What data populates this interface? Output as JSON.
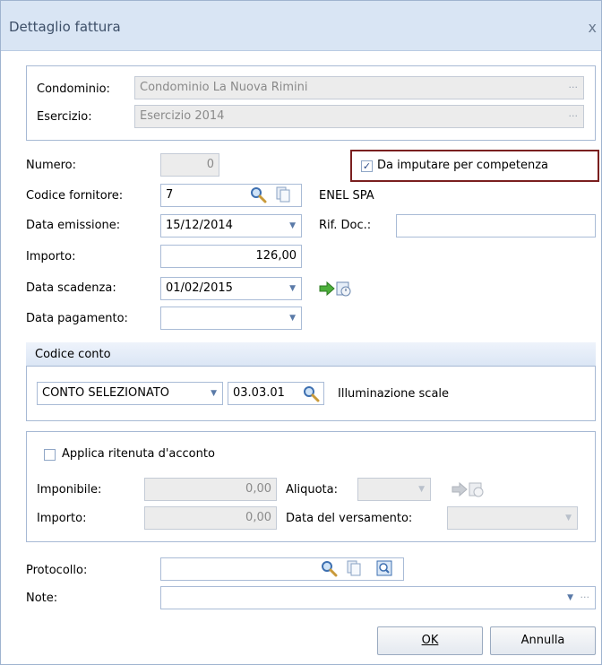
{
  "window": {
    "title": "Dettaglio fattura",
    "close_glyph": "x"
  },
  "group1": {
    "condominio_label": "Condominio:",
    "condominio_value": "Condominio La Nuova Rimini",
    "esercizio_label": "Esercizio:",
    "esercizio_value": "Esercizio 2014",
    "dots": "···"
  },
  "form": {
    "numero_label": "Numero:",
    "numero_value": "0",
    "competenza_label": "Da imputare per competenza",
    "competenza_checked": true,
    "fornitore_label": "Codice fornitore:",
    "fornitore_value": "7",
    "fornitore_name": "ENEL SPA",
    "emissione_label": "Data emissione:",
    "emissione_value": "15/12/2014",
    "rifdoc_label": "Rif. Doc.:",
    "rifdoc_value": "",
    "importo_label": "Importo:",
    "importo_value": "126,00",
    "scadenza_label": "Data scadenza:",
    "scadenza_value": "01/02/2015",
    "pagamento_label": "Data pagamento:",
    "pagamento_value": ""
  },
  "conto": {
    "header": "Codice conto",
    "tipo_value": "CONTO SELEZIONATO",
    "codice_value": "03.03.01",
    "descrizione": "Illuminazione scale"
  },
  "ritenuta": {
    "checkbox_label": "Applica ritenuta d'acconto",
    "checked": false,
    "imponibile_label": "Imponibile:",
    "imponibile_value": "0,00",
    "aliquota_label": "Aliquota:",
    "aliquota_value": "",
    "importo_label": "Importo:",
    "importo_value": "0,00",
    "versamento_label": "Data del versamento:",
    "versamento_value": ""
  },
  "footer": {
    "protocollo_label": "Protocollo:",
    "protocollo_value": "",
    "note_label": "Note:",
    "note_value": "",
    "ok_label": "OK",
    "annulla_label": "Annulla"
  },
  "colors": {
    "accent": "#5a7aa8",
    "highlight_border": "#7a1f1f",
    "group_border": "#a7b9d4"
  },
  "icons": [
    "search-icon",
    "copy-doc-icon",
    "arrow-right-icon",
    "calendar-icon",
    "preview-icon",
    "dropdown-caret-icon",
    "ellipsis-icon",
    "close-icon"
  ]
}
